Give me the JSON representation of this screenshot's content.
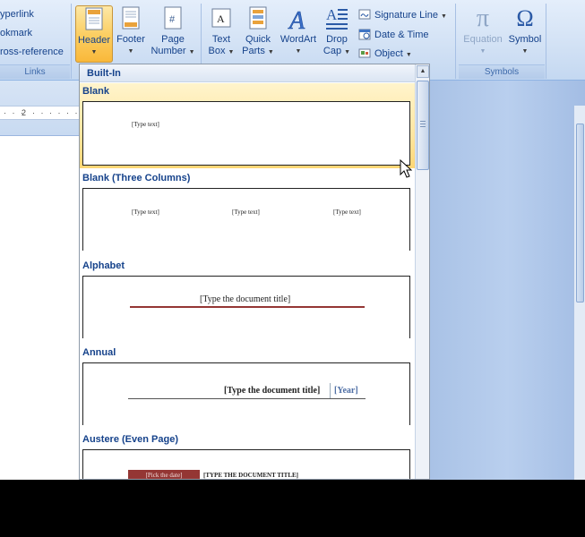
{
  "ribbon": {
    "links_group": {
      "items": [
        "yperlink",
        "okmark",
        "ross-reference"
      ],
      "label": "Links"
    },
    "header_footer": {
      "header": "Header",
      "footer": "Footer",
      "page_number_1": "Page",
      "page_number_2": "Number"
    },
    "text_group": {
      "text_box_1": "Text",
      "text_box_2": "Box",
      "quick_parts_1": "Quick",
      "quick_parts_2": "Parts",
      "wordart": "WordArt",
      "drop_cap_1": "Drop",
      "drop_cap_2": "Cap",
      "signature_line": "Signature Line",
      "date_time": "Date & Time",
      "object": "Object"
    },
    "symbols_group": {
      "equation": "Equation",
      "symbol": "Symbol",
      "label": "Symbols",
      "pi_glyph": "π",
      "omega_glyph": "Ω"
    }
  },
  "ruler": {
    "mark": "2"
  },
  "gallery": {
    "section": "Built-In",
    "items": [
      {
        "title": "Blank",
        "placeholders": [
          "[Type text]"
        ]
      },
      {
        "title": "Blank (Three Columns)",
        "placeholders": [
          "[Type text]",
          "[Type text]",
          "[Type text]"
        ]
      },
      {
        "title": "Alphabet",
        "placeholders": [
          "[Type the document title]"
        ]
      },
      {
        "title": "Annual",
        "placeholders": [
          "[Type the document title]",
          "[Year]"
        ]
      },
      {
        "title": "Austere (Even Page)",
        "placeholders": [
          "[Pick the date]",
          "[TYPE THE DOCUMENT TITLE]"
        ]
      }
    ]
  },
  "colors": {
    "accent_text": "#15428b",
    "header_active": "#f9b83a",
    "alphabet_rule": "#943634",
    "annual_year": "#4f6fa5"
  }
}
